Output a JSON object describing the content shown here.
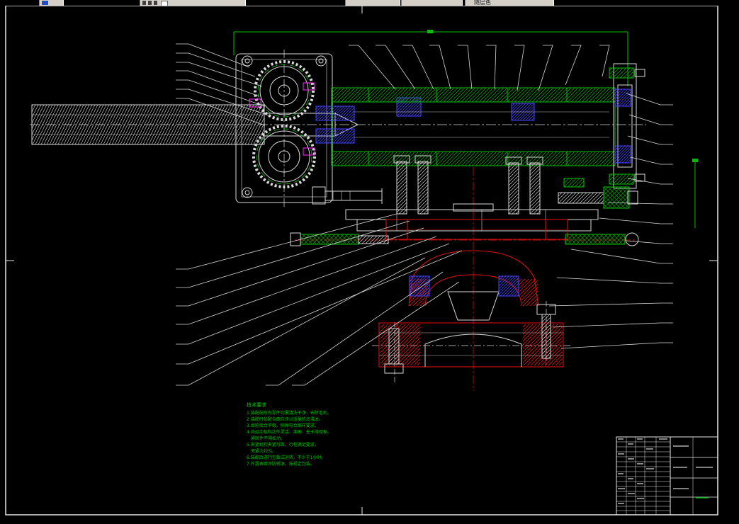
{
  "app": {
    "kind": "CAD drawing workspace",
    "background": "#000000"
  },
  "toolbar": {
    "fragment_note": "bottom edge of toolbar controls clipped at top of capture",
    "color_dropdown_label": "随层色"
  },
  "notes": {
    "title": "技术要求",
    "lines": [
      "1.装配前所有零件均需清洗干净，去除毛刺。",
      "2.装配时各配合面应涂以适量的润滑油。",
      "3.齿轮啮合平稳，侧隙符合图样要求。",
      "4.各运动机构动作灵活、准确，无卡滞现象。",
      "紧固件不得松动。",
      "5.夹紧机构夹紧可靠，行程满足要求，",
      "夹紧力均匀。",
      "6.装配后进行空载试运转，不少于1小时。",
      "7.外露表面涂防锈油，按规定包装。"
    ]
  },
  "colors": {
    "frame_white": "#e8e8e8",
    "line_white": "#d8d8d8",
    "line_green": "#00c000",
    "line_red": "#e81010",
    "line_blue": "#4444ff",
    "line_magenta": "#ff30ff",
    "toolbar_gray": "#d4d0c8",
    "notes_green": "#00c400"
  },
  "title_block": {
    "location": "bottom-right",
    "legible_text": ""
  }
}
